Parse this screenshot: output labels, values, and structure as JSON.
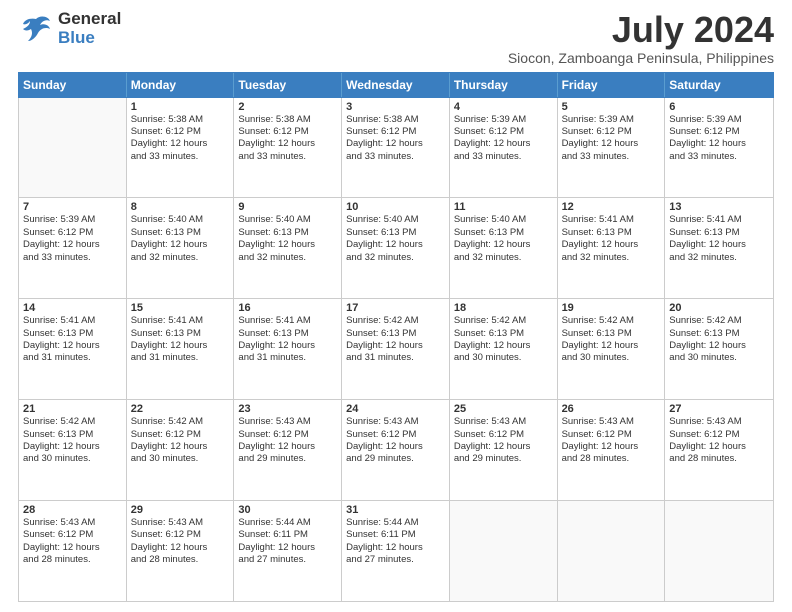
{
  "logo": {
    "general": "General",
    "blue": "Blue"
  },
  "title": "July 2024",
  "subtitle": "Siocon, Zamboanga Peninsula, Philippines",
  "days": [
    "Sunday",
    "Monday",
    "Tuesday",
    "Wednesday",
    "Thursday",
    "Friday",
    "Saturday"
  ],
  "weeks": [
    [
      {
        "day": "",
        "sunrise": "",
        "sunset": "",
        "daylight": ""
      },
      {
        "day": "1",
        "sunrise": "Sunrise: 5:38 AM",
        "sunset": "Sunset: 6:12 PM",
        "daylight": "Daylight: 12 hours",
        "daylight2": "and 33 minutes."
      },
      {
        "day": "2",
        "sunrise": "Sunrise: 5:38 AM",
        "sunset": "Sunset: 6:12 PM",
        "daylight": "Daylight: 12 hours",
        "daylight2": "and 33 minutes."
      },
      {
        "day": "3",
        "sunrise": "Sunrise: 5:38 AM",
        "sunset": "Sunset: 6:12 PM",
        "daylight": "Daylight: 12 hours",
        "daylight2": "and 33 minutes."
      },
      {
        "day": "4",
        "sunrise": "Sunrise: 5:39 AM",
        "sunset": "Sunset: 6:12 PM",
        "daylight": "Daylight: 12 hours",
        "daylight2": "and 33 minutes."
      },
      {
        "day": "5",
        "sunrise": "Sunrise: 5:39 AM",
        "sunset": "Sunset: 6:12 PM",
        "daylight": "Daylight: 12 hours",
        "daylight2": "and 33 minutes."
      },
      {
        "day": "6",
        "sunrise": "Sunrise: 5:39 AM",
        "sunset": "Sunset: 6:12 PM",
        "daylight": "Daylight: 12 hours",
        "daylight2": "and 33 minutes."
      }
    ],
    [
      {
        "day": "7",
        "sunrise": "Sunrise: 5:39 AM",
        "sunset": "Sunset: 6:12 PM",
        "daylight": "Daylight: 12 hours",
        "daylight2": "and 33 minutes."
      },
      {
        "day": "8",
        "sunrise": "Sunrise: 5:40 AM",
        "sunset": "Sunset: 6:13 PM",
        "daylight": "Daylight: 12 hours",
        "daylight2": "and 32 minutes."
      },
      {
        "day": "9",
        "sunrise": "Sunrise: 5:40 AM",
        "sunset": "Sunset: 6:13 PM",
        "daylight": "Daylight: 12 hours",
        "daylight2": "and 32 minutes."
      },
      {
        "day": "10",
        "sunrise": "Sunrise: 5:40 AM",
        "sunset": "Sunset: 6:13 PM",
        "daylight": "Daylight: 12 hours",
        "daylight2": "and 32 minutes."
      },
      {
        "day": "11",
        "sunrise": "Sunrise: 5:40 AM",
        "sunset": "Sunset: 6:13 PM",
        "daylight": "Daylight: 12 hours",
        "daylight2": "and 32 minutes."
      },
      {
        "day": "12",
        "sunrise": "Sunrise: 5:41 AM",
        "sunset": "Sunset: 6:13 PM",
        "daylight": "Daylight: 12 hours",
        "daylight2": "and 32 minutes."
      },
      {
        "day": "13",
        "sunrise": "Sunrise: 5:41 AM",
        "sunset": "Sunset: 6:13 PM",
        "daylight": "Daylight: 12 hours",
        "daylight2": "and 32 minutes."
      }
    ],
    [
      {
        "day": "14",
        "sunrise": "Sunrise: 5:41 AM",
        "sunset": "Sunset: 6:13 PM",
        "daylight": "Daylight: 12 hours",
        "daylight2": "and 31 minutes."
      },
      {
        "day": "15",
        "sunrise": "Sunrise: 5:41 AM",
        "sunset": "Sunset: 6:13 PM",
        "daylight": "Daylight: 12 hours",
        "daylight2": "and 31 minutes."
      },
      {
        "day": "16",
        "sunrise": "Sunrise: 5:41 AM",
        "sunset": "Sunset: 6:13 PM",
        "daylight": "Daylight: 12 hours",
        "daylight2": "and 31 minutes."
      },
      {
        "day": "17",
        "sunrise": "Sunrise: 5:42 AM",
        "sunset": "Sunset: 6:13 PM",
        "daylight": "Daylight: 12 hours",
        "daylight2": "and 31 minutes."
      },
      {
        "day": "18",
        "sunrise": "Sunrise: 5:42 AM",
        "sunset": "Sunset: 6:13 PM",
        "daylight": "Daylight: 12 hours",
        "daylight2": "and 30 minutes."
      },
      {
        "day": "19",
        "sunrise": "Sunrise: 5:42 AM",
        "sunset": "Sunset: 6:13 PM",
        "daylight": "Daylight: 12 hours",
        "daylight2": "and 30 minutes."
      },
      {
        "day": "20",
        "sunrise": "Sunrise: 5:42 AM",
        "sunset": "Sunset: 6:13 PM",
        "daylight": "Daylight: 12 hours",
        "daylight2": "and 30 minutes."
      }
    ],
    [
      {
        "day": "21",
        "sunrise": "Sunrise: 5:42 AM",
        "sunset": "Sunset: 6:13 PM",
        "daylight": "Daylight: 12 hours",
        "daylight2": "and 30 minutes."
      },
      {
        "day": "22",
        "sunrise": "Sunrise: 5:42 AM",
        "sunset": "Sunset: 6:12 PM",
        "daylight": "Daylight: 12 hours",
        "daylight2": "and 30 minutes."
      },
      {
        "day": "23",
        "sunrise": "Sunrise: 5:43 AM",
        "sunset": "Sunset: 6:12 PM",
        "daylight": "Daylight: 12 hours",
        "daylight2": "and 29 minutes."
      },
      {
        "day": "24",
        "sunrise": "Sunrise: 5:43 AM",
        "sunset": "Sunset: 6:12 PM",
        "daylight": "Daylight: 12 hours",
        "daylight2": "and 29 minutes."
      },
      {
        "day": "25",
        "sunrise": "Sunrise: 5:43 AM",
        "sunset": "Sunset: 6:12 PM",
        "daylight": "Daylight: 12 hours",
        "daylight2": "and 29 minutes."
      },
      {
        "day": "26",
        "sunrise": "Sunrise: 5:43 AM",
        "sunset": "Sunset: 6:12 PM",
        "daylight": "Daylight: 12 hours",
        "daylight2": "and 28 minutes."
      },
      {
        "day": "27",
        "sunrise": "Sunrise: 5:43 AM",
        "sunset": "Sunset: 6:12 PM",
        "daylight": "Daylight: 12 hours",
        "daylight2": "and 28 minutes."
      }
    ],
    [
      {
        "day": "28",
        "sunrise": "Sunrise: 5:43 AM",
        "sunset": "Sunset: 6:12 PM",
        "daylight": "Daylight: 12 hours",
        "daylight2": "and 28 minutes."
      },
      {
        "day": "29",
        "sunrise": "Sunrise: 5:43 AM",
        "sunset": "Sunset: 6:12 PM",
        "daylight": "Daylight: 12 hours",
        "daylight2": "and 28 minutes."
      },
      {
        "day": "30",
        "sunrise": "Sunrise: 5:44 AM",
        "sunset": "Sunset: 6:11 PM",
        "daylight": "Daylight: 12 hours",
        "daylight2": "and 27 minutes."
      },
      {
        "day": "31",
        "sunrise": "Sunrise: 5:44 AM",
        "sunset": "Sunset: 6:11 PM",
        "daylight": "Daylight: 12 hours",
        "daylight2": "and 27 minutes."
      },
      {
        "day": "",
        "sunrise": "",
        "sunset": "",
        "daylight": "",
        "daylight2": ""
      },
      {
        "day": "",
        "sunrise": "",
        "sunset": "",
        "daylight": "",
        "daylight2": ""
      },
      {
        "day": "",
        "sunrise": "",
        "sunset": "",
        "daylight": "",
        "daylight2": ""
      }
    ]
  ]
}
